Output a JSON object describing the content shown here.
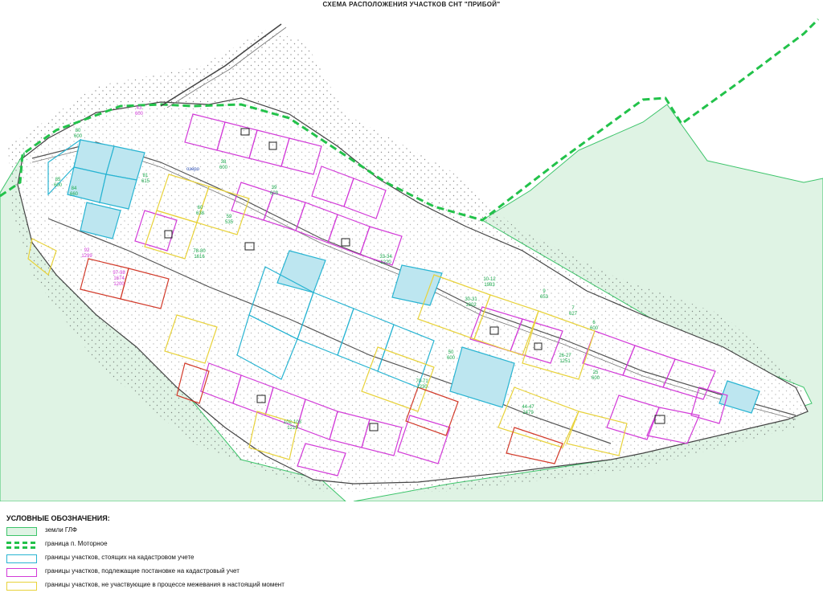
{
  "title": "СХЕМА РАСПОЛОЖЕНИЯ УЧАСТКОВ СНТ \"ПРИБОЙ\"",
  "colors": {
    "glf_fill": "#dff3e4",
    "glf_border": "#3cc46a",
    "boundary_dashed": "#22c24a",
    "cadastral": "#28b4d2",
    "cadastral_fill": "#bde6f0",
    "pending": "#d23ad8",
    "not_participating": "#e8d23a",
    "conflict": "#d23a2a",
    "road": "#555555",
    "label_green": "#18a84a",
    "label_magenta": "#d23ad8"
  },
  "map": {
    "place_label": "озеро",
    "plot_labels": [
      {
        "id": "43",
        "area": "600",
        "color": "magenta"
      },
      {
        "id": "80",
        "area": "600",
        "color": "green"
      },
      {
        "id": "85",
        "area": "600",
        "color": "green"
      },
      {
        "id": "84",
        "area": "660",
        "color": "green"
      },
      {
        "id": "81",
        "area": "615",
        "color": "green"
      },
      {
        "id": "60",
        "area": "638",
        "color": "green"
      },
      {
        "id": "59",
        "area": "535",
        "color": "green"
      },
      {
        "id": "38",
        "area": "600",
        "color": "green"
      },
      {
        "id": "39",
        "area": "603",
        "color": "green"
      },
      {
        "id": "92",
        "area": "1299",
        "color": "magenta"
      },
      {
        "id": "97-98",
        "area": "1674",
        "color": "magenta"
      },
      {
        "id": "",
        "area": "1200",
        "color": "magenta"
      },
      {
        "id": "78-80",
        "area": "1616",
        "color": "green"
      },
      {
        "id": "33-34",
        "area": "1220",
        "color": "green"
      },
      {
        "id": "10-12",
        "area": "1983",
        "color": "green"
      },
      {
        "id": "30-31",
        "area": "1302",
        "color": "green"
      },
      {
        "id": "9",
        "area": "653",
        "color": "green"
      },
      {
        "id": "7",
        "area": "627",
        "color": "green"
      },
      {
        "id": "6",
        "area": "600",
        "color": "green"
      },
      {
        "id": "26-27",
        "area": "1251",
        "color": "green"
      },
      {
        "id": "25",
        "area": "600",
        "color": "green"
      },
      {
        "id": "70-71",
        "area": "1230",
        "color": "green"
      },
      {
        "id": "44-47",
        "area": "2479",
        "color": "green"
      },
      {
        "id": "102-103",
        "area": "1219",
        "color": "green"
      },
      {
        "id": "50",
        "area": "600",
        "color": "green"
      }
    ]
  },
  "legend": {
    "heading": "УСЛОВНЫЕ ОБОЗНАЧЕНИЯ:",
    "items": [
      {
        "label": "земли ГЛФ",
        "style": "glf"
      },
      {
        "label": "граница п. Моторное",
        "style": "dashed"
      },
      {
        "label": "границы участков, стоящих на кадастровом учете",
        "style": "cadastral"
      },
      {
        "label": "границы участков, подлежащие постановке на кадастровый учет",
        "style": "pending"
      },
      {
        "label": "границы участков, не участвующие в процессе межевания в настоящий момент",
        "style": "not_participating"
      }
    ]
  }
}
